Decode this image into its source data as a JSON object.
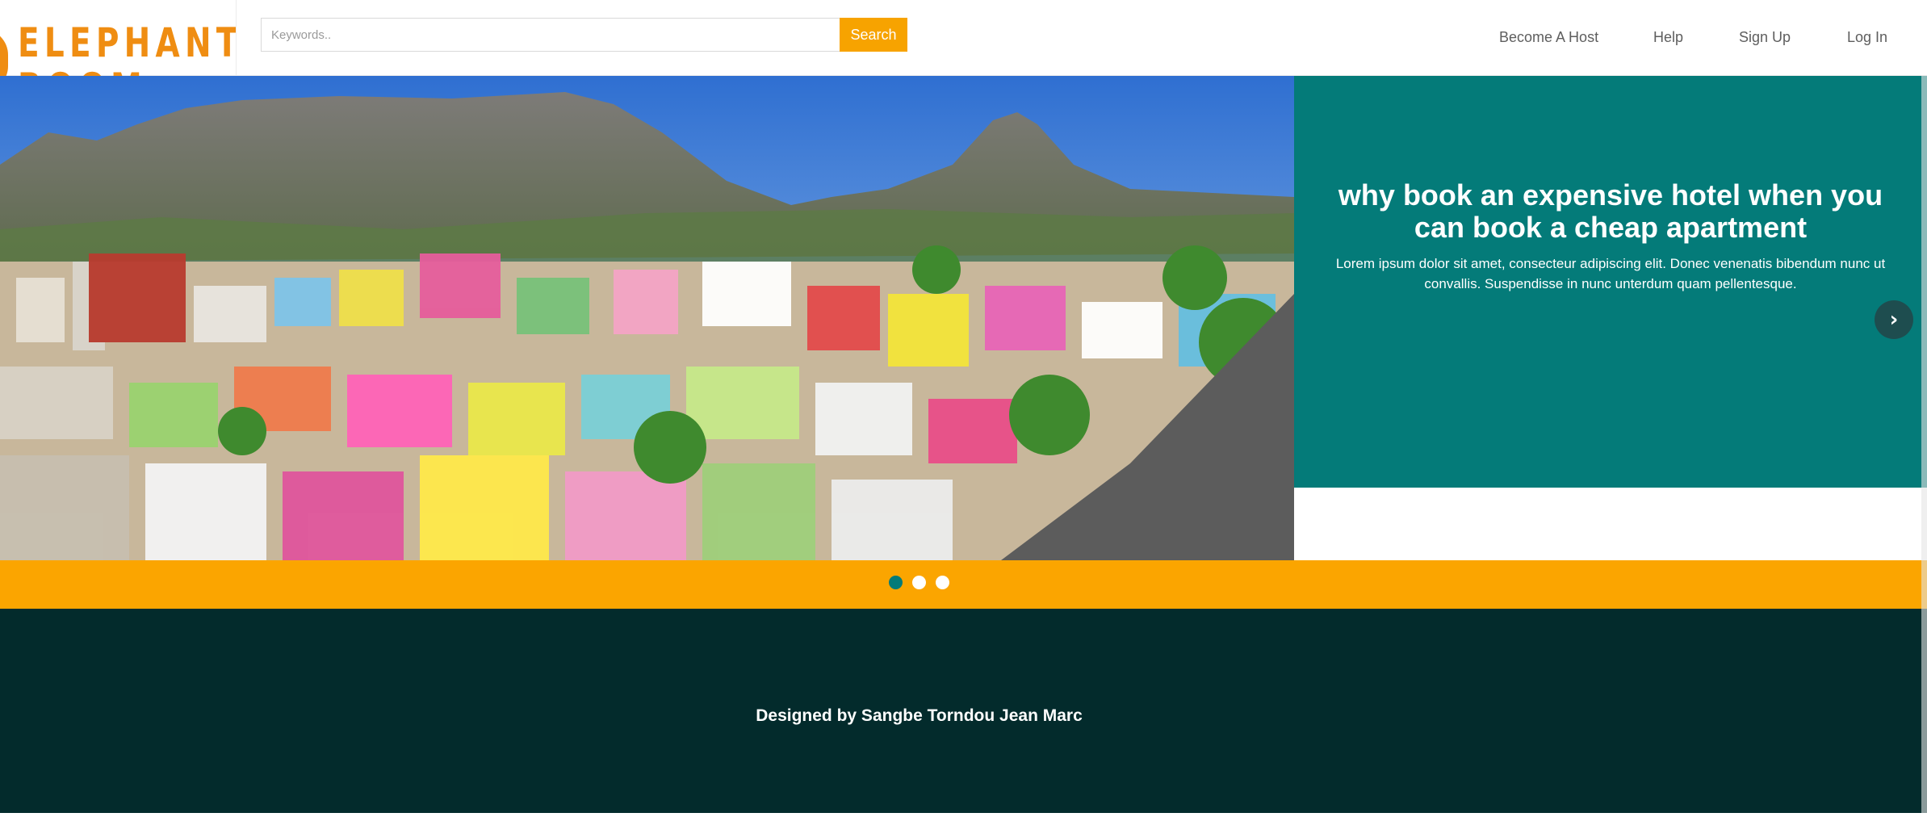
{
  "brand": {
    "logo_line1": "ELEPHANT",
    "logo_line2": "ROOM",
    "logo_icon": "elephant-logo-mark",
    "accent_color": "#ef8d12"
  },
  "search": {
    "placeholder": "Keywords..",
    "value": "",
    "button_label": "Search",
    "icon": "none"
  },
  "nav": {
    "become_host": "Become A Host",
    "help": "Help",
    "sign_up": "Sign Up",
    "log_in": "Log In"
  },
  "hero": {
    "title": "why book an expensive hotel when you can book a cheap apartment",
    "subtitle": "Lorem ipsum dolor sit amet, consecteur adipiscing elit. Donec venenatis bibendum nunc ut convallis. Suspendisse in nunc unterdum quam pellentesque.",
    "next_icon": "chevron-right-icon",
    "next_glyph": "›",
    "panel_color": "#047b79",
    "image": "aerial view of colorful city houses with flat-top mountain"
  },
  "carousel": {
    "slide_count": 3,
    "active_index": 0,
    "bar_color": "#fba500"
  },
  "footer": {
    "credit": "Designed by Sangbe Torndou Jean Marc",
    "background": "#032b2c"
  }
}
